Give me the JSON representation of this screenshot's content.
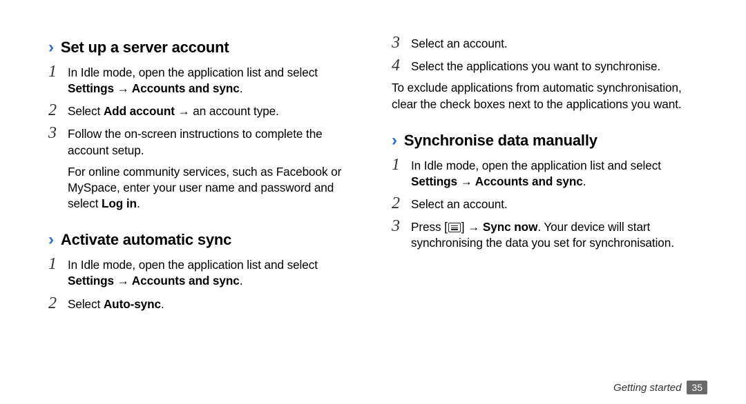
{
  "left": {
    "section1": {
      "title": "Set up a server account",
      "steps": [
        {
          "num": "1",
          "pre": "In Idle mode, open the application list and select ",
          "bold": "Settings → Accounts and sync",
          "post": "."
        },
        {
          "num": "2",
          "pre": "Select ",
          "bold": "Add account",
          "post": " → an account type."
        },
        {
          "num": "3",
          "pre": "Follow the on-screen instructions to complete the account setup.",
          "bold": "",
          "post": ""
        }
      ],
      "note": {
        "pre": "For online community services, such as Facebook or MySpace, enter your user name and password and select ",
        "bold": "Log in",
        "post": "."
      }
    },
    "section2": {
      "title": "Activate automatic sync",
      "steps": [
        {
          "num": "1",
          "pre": "In Idle mode, open the application list and select ",
          "bold": "Settings → Accounts and sync",
          "post": "."
        },
        {
          "num": "2",
          "pre": "Select ",
          "bold": "Auto-sync",
          "post": "."
        }
      ]
    }
  },
  "right": {
    "continued_steps": [
      {
        "num": "3",
        "pre": "Select an account.",
        "bold": "",
        "post": ""
      },
      {
        "num": "4",
        "pre": "Select the applications you want to synchronise.",
        "bold": "",
        "post": ""
      }
    ],
    "note": "To exclude applications from automatic synchronisation, clear the check boxes next to the applications you want.",
    "section3": {
      "title": "Synchronise data manually",
      "steps": [
        {
          "num": "1",
          "pre": "In Idle mode, open the application list and select ",
          "bold": "Settings → Accounts and sync",
          "post": "."
        },
        {
          "num": "2",
          "pre": "Select an account.",
          "bold": "",
          "post": ""
        }
      ],
      "step3": {
        "num": "3",
        "pre": "Press [",
        "mid": "] → ",
        "bold": "Sync now",
        "post": ". Your device will start synchronising the data you set for synchronisation."
      }
    }
  },
  "footer": {
    "chapter": "Getting started",
    "page": "35"
  }
}
